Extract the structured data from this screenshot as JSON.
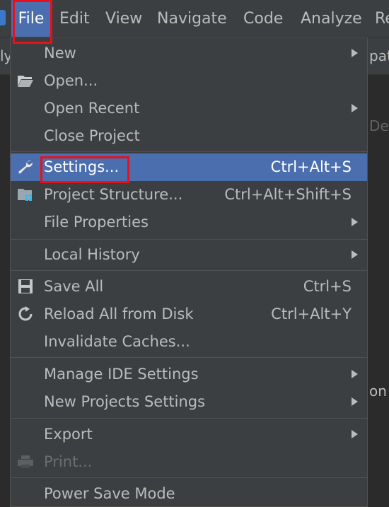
{
  "menubar": {
    "items": [
      "File",
      "Edit",
      "View",
      "Navigate",
      "Code",
      "Analyze",
      "Re"
    ]
  },
  "background": {
    "left_fragment": "ly",
    "right_fragment_1": "pat",
    "right_fragment_2": "Der",
    "right_fragment_3": "on"
  },
  "file_menu": {
    "new": "New",
    "open": "Open...",
    "open_recent": "Open Recent",
    "close_project": "Close Project",
    "settings": "Settings...",
    "settings_shortcut": "Ctrl+Alt+S",
    "project_structure": "Project Structure...",
    "project_structure_shortcut": "Ctrl+Alt+Shift+S",
    "file_properties": "File Properties",
    "local_history": "Local History",
    "save_all": "Save All",
    "save_all_shortcut": "Ctrl+S",
    "reload_all": "Reload All from Disk",
    "reload_all_shortcut": "Ctrl+Alt+Y",
    "invalidate_caches": "Invalidate Caches...",
    "manage_ide_settings": "Manage IDE Settings",
    "new_projects_settings": "New Projects Settings",
    "export": "Export",
    "print": "Print...",
    "power_save_mode": "Power Save Mode"
  },
  "colors": {
    "menu_bg": "#3c3f41",
    "selected": "#4b6eaf",
    "highlight_box": "#e8101a"
  }
}
